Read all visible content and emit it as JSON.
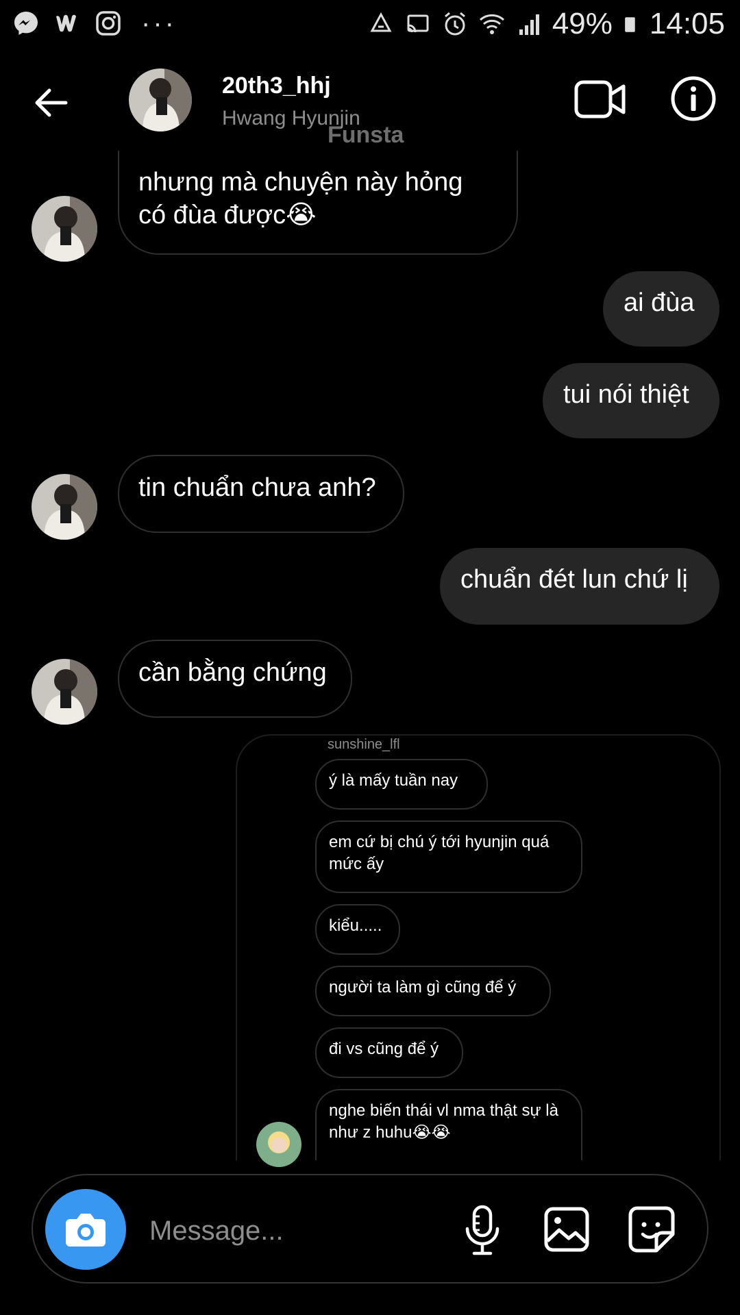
{
  "status_bar": {
    "battery": "49%",
    "time": "14:05",
    "left_icons": [
      "messenger-icon",
      "wattpad-icon",
      "instagram-icon",
      "more-dots-icon"
    ],
    "right_icons": [
      "recycle-icon",
      "cast-icon",
      "alarm-icon",
      "wifi-icon",
      "signal-icon",
      "battery-icon"
    ]
  },
  "header": {
    "username": "20th3_hhj",
    "full_name": "Hwang Hyunjin",
    "overlay_label": "Funsta"
  },
  "messages": [
    {
      "side": "in",
      "text": "nhưng mà chuyện này hỏng có đùa được😭"
    },
    {
      "side": "out",
      "text": "ai đùa"
    },
    {
      "side": "out",
      "text": "tui nói thiệt"
    },
    {
      "side": "in",
      "text": "tin chuẩn chưa anh?"
    },
    {
      "side": "out",
      "text": "chuẩn đét lun chứ lị"
    },
    {
      "side": "in",
      "text": "cần bằng chứng"
    }
  ],
  "shared_post": {
    "username": "sunshine_lfl",
    "lines": [
      "ý là mấy tuần nay",
      "em cứ bị chú ý tới hyunjin quá mức ấy",
      "kiểu.....",
      "người ta làm gì cũng để ý",
      "đi vs cũng để ý",
      "nghe biến thái vl nma thật sự là như z huhu😭😭"
    ]
  },
  "composer": {
    "placeholder": "Message..."
  },
  "colors": {
    "background": "#000000",
    "outgoing_bubble": "#262626",
    "incoming_border": "#2e2e2e",
    "camera_button": "#3897f0",
    "secondary_text": "#8e8e8e"
  }
}
